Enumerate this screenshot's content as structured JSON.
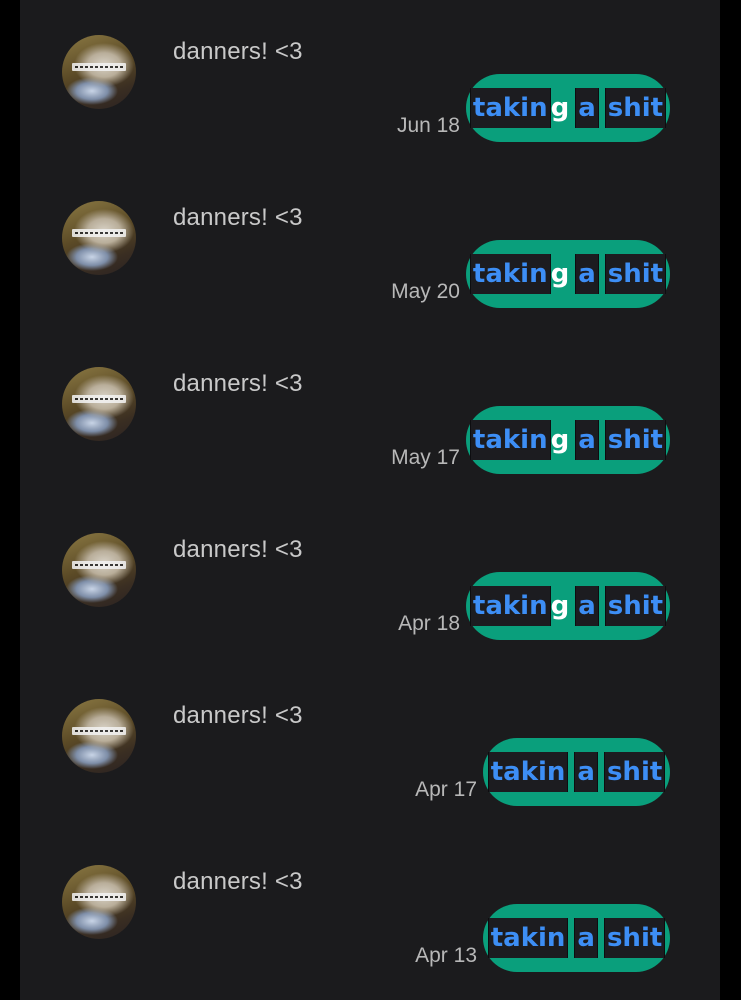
{
  "messages": [
    {
      "sender": "danners! <3",
      "date": "Jun 18",
      "text_parts": {
        "part1": "takin",
        "part2": "g",
        "part3": "a",
        "part4": "shit"
      }
    },
    {
      "sender": "danners! <3",
      "date": "May 20",
      "text_parts": {
        "part1": "takin",
        "part2": "g",
        "part3": "a",
        "part4": "shit"
      }
    },
    {
      "sender": "danners! <3",
      "date": "May 17",
      "text_parts": {
        "part1": "takin",
        "part2": "g",
        "part3": "a",
        "part4": "shit"
      }
    },
    {
      "sender": "danners! <3",
      "date": "Apr 18",
      "text_parts": {
        "part1": "takin",
        "part2": "g",
        "part3": "a",
        "part4": "shit"
      }
    },
    {
      "sender": "danners! <3",
      "date": "Apr 17",
      "text_parts": {
        "part1": "takin",
        "part3": "a",
        "part4": "shit"
      }
    },
    {
      "sender": "danners! <3",
      "date": "Apr 13",
      "text_parts": {
        "part1": "takin",
        "part3": "a",
        "part4": "shit"
      }
    }
  ],
  "colors": {
    "background": "#1b1b1d",
    "bubble": "#0a9f7c",
    "highlight_text": "#3d8ef5",
    "highlight_bg": "#1c1c20",
    "name_text": "#c9c9c9",
    "date_text": "#b8b8b8"
  },
  "icons": {
    "avatar": "cat-photo-avatar"
  }
}
